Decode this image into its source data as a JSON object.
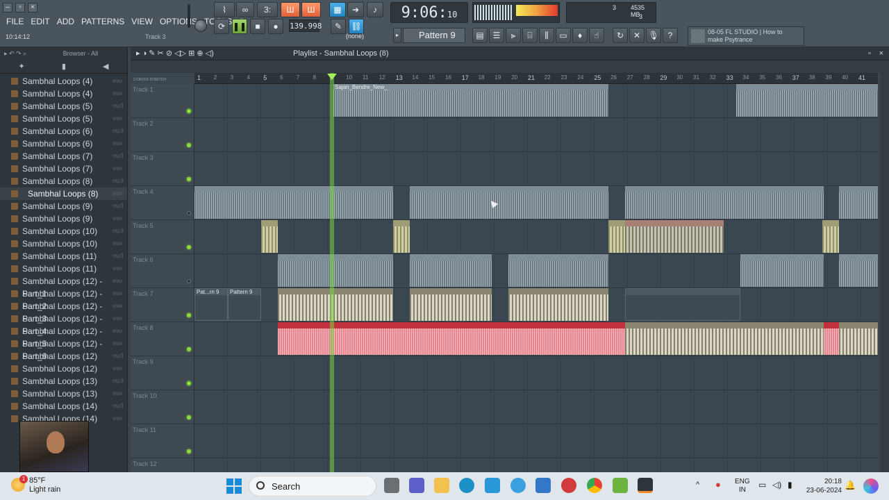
{
  "window": {
    "clock_small": "10:14:12",
    "track_hint": "Track 3"
  },
  "menu": [
    "FILE",
    "EDIT",
    "ADD",
    "PATTERNS",
    "VIEW",
    "OPTIONS",
    "TOOLS",
    "?"
  ],
  "transport": {
    "time_main": "9:06",
    "time_sub": "10",
    "tempo": "139.998",
    "snap": "(none)",
    "pattern": "Pattern 9",
    "cpu_count": "3",
    "memory": "4535 MB",
    "poly": "3"
  },
  "news": {
    "line1": "08-05  FL STUDIO | How to",
    "line2": "make Psytrance"
  },
  "browser": {
    "title": "Browser - All",
    "items": [
      {
        "name": "Sambhal Loops (4)",
        "ext": "wav"
      },
      {
        "name": "Sambhal Loops (4)",
        "ext": "wav"
      },
      {
        "name": "Sambhal Loops (5)",
        "ext": "mp3"
      },
      {
        "name": "Sambhal Loops (5)",
        "ext": "wav"
      },
      {
        "name": "Sambhal Loops (6)",
        "ext": "mp3"
      },
      {
        "name": "Sambhal Loops (6)",
        "ext": "wav"
      },
      {
        "name": "Sambhal Loops (7)",
        "ext": "mp3"
      },
      {
        "name": "Sambhal Loops (7)",
        "ext": "wav"
      },
      {
        "name": "Sambhal Loops (8)",
        "ext": "mp3"
      },
      {
        "name": "Sambhal Loops (8)",
        "ext": "wav"
      },
      {
        "name": "Sambhal Loops (9)",
        "ext": "mp3"
      },
      {
        "name": "Sambhal Loops (9)",
        "ext": "wav"
      },
      {
        "name": "Sambhal Loops (10)",
        "ext": "mp3"
      },
      {
        "name": "Sambhal Loops (10)",
        "ext": "wav"
      },
      {
        "name": "Sambhal Loops (11)",
        "ext": "mp3"
      },
      {
        "name": "Sambhal Loops (11)",
        "ext": "wav"
      },
      {
        "name": "Sambhal Loops (12) - Part_1",
        "ext": "wav"
      },
      {
        "name": "Sambhal Loops (12) - Part_2",
        "ext": "wav"
      },
      {
        "name": "Sambhal Loops (12) - Part_3",
        "ext": "wav"
      },
      {
        "name": "Sambhal Loops (12) - Part_4",
        "ext": "wav"
      },
      {
        "name": "Sambhal Loops (12) - Part_5",
        "ext": "wav"
      },
      {
        "name": "Sambhal Loops (12) - Part_6",
        "ext": "wav"
      },
      {
        "name": "Sambhal Loops (12)",
        "ext": "mp3"
      },
      {
        "name": "Sambhal Loops (12)",
        "ext": "wav"
      },
      {
        "name": "Sambhal Loops (13)",
        "ext": "mp3"
      },
      {
        "name": "Sambhal Loops (13)",
        "ext": "wav"
      },
      {
        "name": "Sambhal Loops (14)",
        "ext": "mp3"
      },
      {
        "name": "Sambhal Loops (14)",
        "ext": "wav"
      }
    ],
    "selected_index": 9
  },
  "playlist": {
    "title": "Playlist - Sambhal Loops (8)",
    "ruler_label": "2 CROSS  STRETCH",
    "bars": [
      "1",
      "2",
      "3",
      "4",
      "5",
      "6",
      "7",
      "8",
      "9",
      "10",
      "11",
      "12",
      "13",
      "14",
      "15",
      "16",
      "17",
      "18",
      "19",
      "20",
      "21",
      "22",
      "23",
      "24",
      "25",
      "26",
      "27",
      "28",
      "29",
      "30",
      "31",
      "32",
      "33",
      "34",
      "35",
      "36",
      "37",
      "38",
      "39",
      "40",
      "41"
    ],
    "tracks": [
      "Track 1",
      "Track 2",
      "Track 3",
      "Track 4",
      "Track 5",
      "Track 6",
      "Track 7",
      "Track 8",
      "Track 9",
      "Track 10",
      "Track 11",
      "Track 12"
    ],
    "track1_clip": "Sajan_Bendre_New_",
    "track7_clip_a": "Pat...rn 9",
    "track7_clip_b": "Pattern 9"
  },
  "taskbar": {
    "temp": "85°F",
    "weather": "Light rain",
    "weather_badge": "1",
    "search": "Search",
    "lang1": "ENG",
    "lang2": "IN",
    "time": "20:18",
    "date": "23-06-2024"
  }
}
